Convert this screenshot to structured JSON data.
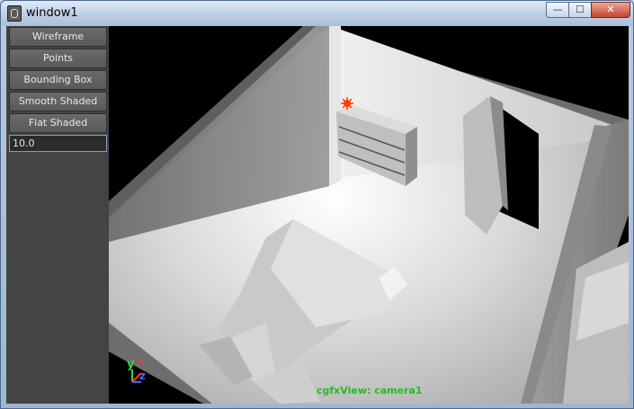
{
  "window": {
    "title": "window1",
    "minimize": "—",
    "maximize": "☐",
    "close": "✕"
  },
  "panel": {
    "buttons": [
      "Wireframe",
      "Points",
      "Bounding Box",
      "Smooth Shaded",
      "Flat Shaded"
    ],
    "value": "10.0"
  },
  "viewport": {
    "label": "cgfxView: camera1",
    "axes": {
      "y": "y",
      "x": "x",
      "z": "z"
    }
  }
}
